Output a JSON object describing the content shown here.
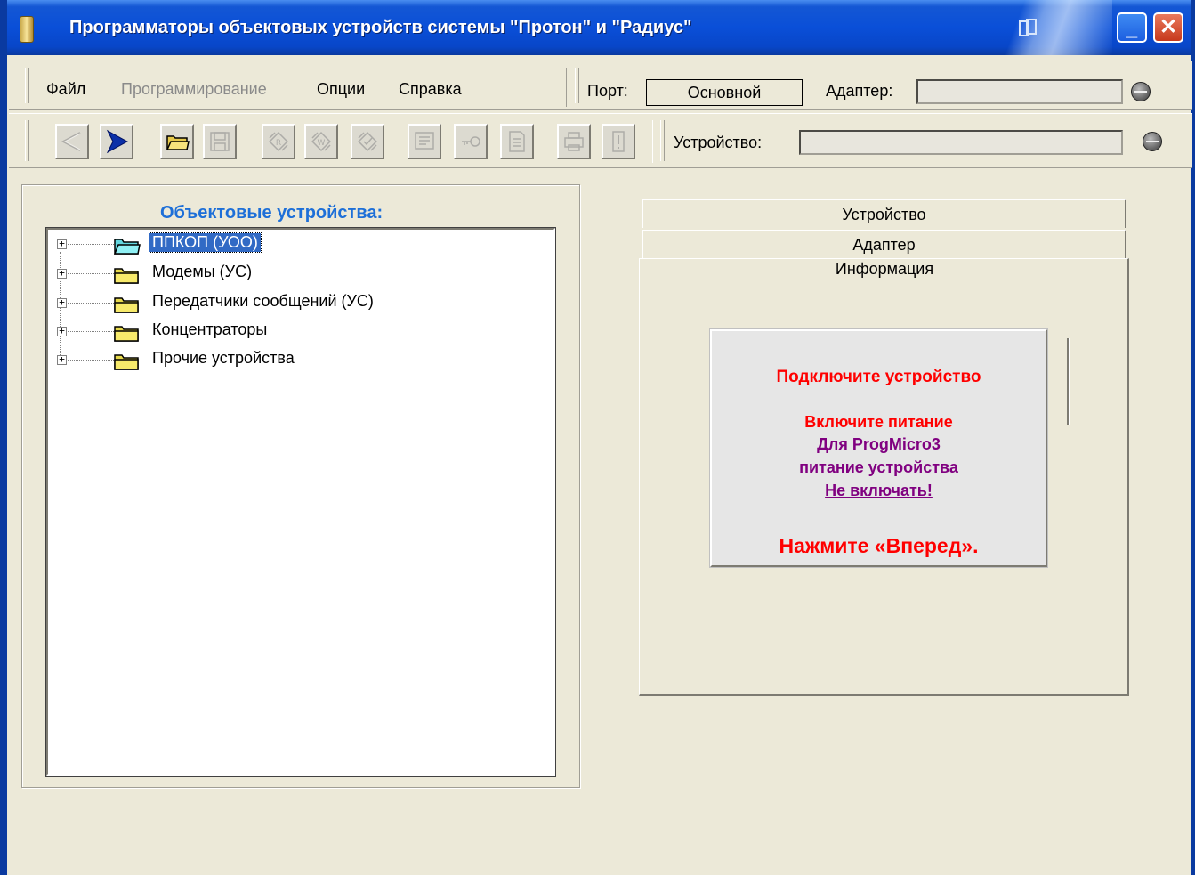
{
  "window": {
    "title": "Программаторы объектовых устройств системы \"Протон\" и \"Радиус\""
  },
  "menu": {
    "items": [
      {
        "label": "Файл",
        "enabled": true
      },
      {
        "label": "Программирование",
        "enabled": false
      },
      {
        "label": "Опции",
        "enabled": true
      },
      {
        "label": "Справка",
        "enabled": true
      }
    ]
  },
  "connection": {
    "port_label": "Порт:",
    "port_value": "Основной",
    "adapter_label": "Адаптер:",
    "adapter_value": "",
    "device_label": "Устройство:",
    "device_value": ""
  },
  "toolbar": {
    "buttons": [
      {
        "icon": "back-arrow-icon",
        "enabled": false
      },
      {
        "icon": "forward-arrow-icon",
        "enabled": true
      },
      {
        "icon": "open-folder-icon",
        "enabled": true
      },
      {
        "icon": "save-disk-icon",
        "enabled": false
      },
      {
        "icon": "read-chip-icon",
        "enabled": false
      },
      {
        "icon": "write-chip-icon",
        "enabled": false
      },
      {
        "icon": "verify-chip-icon",
        "enabled": false
      },
      {
        "icon": "settings-list-icon",
        "enabled": false
      },
      {
        "icon": "key-icon",
        "enabled": false
      },
      {
        "icon": "document-icon",
        "enabled": false
      },
      {
        "icon": "printer-icon",
        "enabled": false
      },
      {
        "icon": "info-icon",
        "enabled": false
      }
    ]
  },
  "tree": {
    "title": "Объектовые устройства:",
    "items": [
      {
        "label": "ППКОП (УОО)",
        "selected": true
      },
      {
        "label": "Модемы (УС)",
        "selected": false
      },
      {
        "label": "Передатчики сообщений (УС)",
        "selected": false
      },
      {
        "label": "Концентраторы",
        "selected": false
      },
      {
        "label": "Прочие устройства",
        "selected": false
      }
    ]
  },
  "tabs": {
    "device": "Устройство",
    "adapter": "Адаптер",
    "info": "Информация"
  },
  "info": {
    "line1": "Подключите устройство",
    "line2": "Включите питание",
    "line3": "Для ProgMicro3",
    "line4": "питание устройства",
    "line5": "Не включать!",
    "line6": "Нажмите «Вперед»."
  },
  "colors": {
    "title_bar": "#0a4fd8",
    "tree_title": "#1d6fd8",
    "selection": "#316ac5",
    "warning_red": "#ff0000",
    "note_purple": "#800080"
  }
}
